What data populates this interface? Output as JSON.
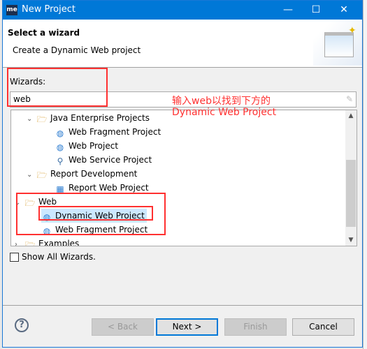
{
  "window": {
    "title": "New Project",
    "app_logo": "me",
    "controls": [
      "minimize",
      "maximize",
      "close"
    ]
  },
  "header": {
    "title": "Select a wizard",
    "description": "Create a Dynamic Web project"
  },
  "wizards": {
    "label": "Wizards:",
    "filter_value": "web"
  },
  "tree": [
    {
      "label": "Java Enterprise Projects",
      "type": "folder",
      "expanded": true,
      "level": 1
    },
    {
      "label": "Web Fragment Project",
      "type": "item",
      "level": 2
    },
    {
      "label": "Web Project",
      "type": "item",
      "level": 2
    },
    {
      "label": "Web Service Project",
      "type": "item",
      "level": 2
    },
    {
      "label": "Report Development",
      "type": "folder",
      "expanded": true,
      "level": 1
    },
    {
      "label": "Report Web Project",
      "type": "item",
      "level": 2
    },
    {
      "label": "Web",
      "type": "folder",
      "expanded": true,
      "level": 0
    },
    {
      "label": "Dynamic Web Project",
      "type": "item",
      "level": 1,
      "selected": true
    },
    {
      "label": "Web Fragment Project",
      "type": "item",
      "level": 1
    },
    {
      "label": "Examples",
      "type": "folder",
      "expanded": false,
      "level": 0
    }
  ],
  "show_all": {
    "label": "Show All Wizards.",
    "checked": false
  },
  "buttons": {
    "back": "< Back",
    "next": "Next >",
    "finish": "Finish",
    "cancel": "Cancel"
  },
  "annotation": {
    "line1": "输入web以找到下方的",
    "line2": "Dynamic Web Project",
    "color": "#ff3030"
  },
  "colors": {
    "titlebar": "#0078d7",
    "selection": "#cce8ff"
  }
}
